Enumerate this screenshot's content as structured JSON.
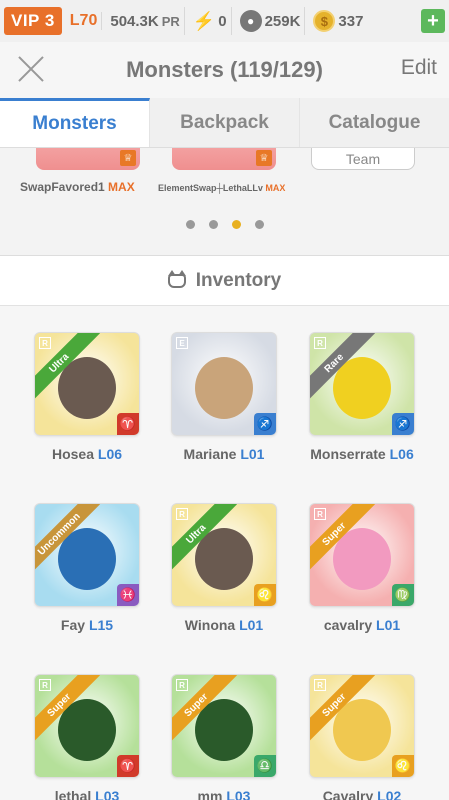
{
  "status": {
    "vip": "VIP 3",
    "level": "L70",
    "power": "504.3K",
    "power_unit": "PR",
    "energy": "0",
    "food": "259K",
    "coins": "337",
    "add_label": "+"
  },
  "header": {
    "title": "Monsters (119/129)",
    "edit": "Edit"
  },
  "tabs": [
    "Monsters",
    "Backpack",
    "Catalogue"
  ],
  "team": {
    "slot1_name": "SwapFavored1",
    "slot1_max": "MAX",
    "slot2_name": "ElementSwap┼LethaLLv",
    "slot2_max": "MAX",
    "button": "Team"
  },
  "inventory": {
    "title": "Inventory",
    "items": [
      {
        "name": "Hosea",
        "level": "L06",
        "rarity": "Ultra",
        "ribbon": "#4aa83a",
        "bg": "#f5e49a",
        "badge": "#d13a2a",
        "zodiac": "♈",
        "r": "R",
        "rcolor": "#7a4cb5",
        "body": "#6a5a50"
      },
      {
        "name": "Mariane",
        "level": "L01",
        "rarity": "",
        "ribbon": "",
        "bg": "#d6dbe4",
        "badge": "#3a7fd0",
        "zodiac": "♐",
        "r": "E",
        "rcolor": "#aaa",
        "body": "#c9a47a"
      },
      {
        "name": "Monserrate",
        "level": "L06",
        "rarity": "Rare",
        "ribbon": "#777",
        "bg": "#cfe4a8",
        "badge": "#3a7fd0",
        "zodiac": "♐",
        "r": "R",
        "rcolor": "#7a4cb5",
        "body": "#f0d020"
      },
      {
        "name": "Fay",
        "level": "L15",
        "rarity": "Uncommon",
        "ribbon": "#c8953a",
        "bg": "#a8dcf0",
        "badge": "#8a5bc0",
        "zodiac": "♓",
        "r": "",
        "rcolor": "",
        "body": "#2a6fb5"
      },
      {
        "name": "Winona",
        "level": "L01",
        "rarity": "Ultra",
        "ribbon": "#4aa83a",
        "bg": "#f5e49a",
        "badge": "#e8a020",
        "zodiac": "♌",
        "r": "R",
        "rcolor": "#7a4cb5",
        "body": "#6a5a50"
      },
      {
        "name": "cavalry",
        "level": "L01",
        "rarity": "Super",
        "ribbon": "#e8a020",
        "bg": "#f5b0b0",
        "badge": "#3aa86a",
        "zodiac": "♍",
        "r": "R",
        "rcolor": "#7a4cb5",
        "body": "#f29ac0"
      },
      {
        "name": "lethal",
        "level": "L03",
        "rarity": "Super",
        "ribbon": "#e8a020",
        "bg": "#b5e09a",
        "badge": "#d13a2a",
        "zodiac": "♈",
        "r": "R",
        "rcolor": "#7a4cb5",
        "body": "#2a5a2a"
      },
      {
        "name": "mm",
        "level": "L03",
        "rarity": "Super",
        "ribbon": "#e8a020",
        "bg": "#b5e09a",
        "badge": "#3aa86a",
        "zodiac": "♎",
        "r": "R",
        "rcolor": "#7a4cb5",
        "body": "#2a5a2a"
      },
      {
        "name": "Cavalry",
        "level": "L02",
        "rarity": "Super",
        "ribbon": "#e8a020",
        "bg": "#f5e49a",
        "badge": "#e8a020",
        "zodiac": "♌",
        "r": "R",
        "rcolor": "#7a4cb5",
        "body": "#f0c850"
      }
    ]
  }
}
